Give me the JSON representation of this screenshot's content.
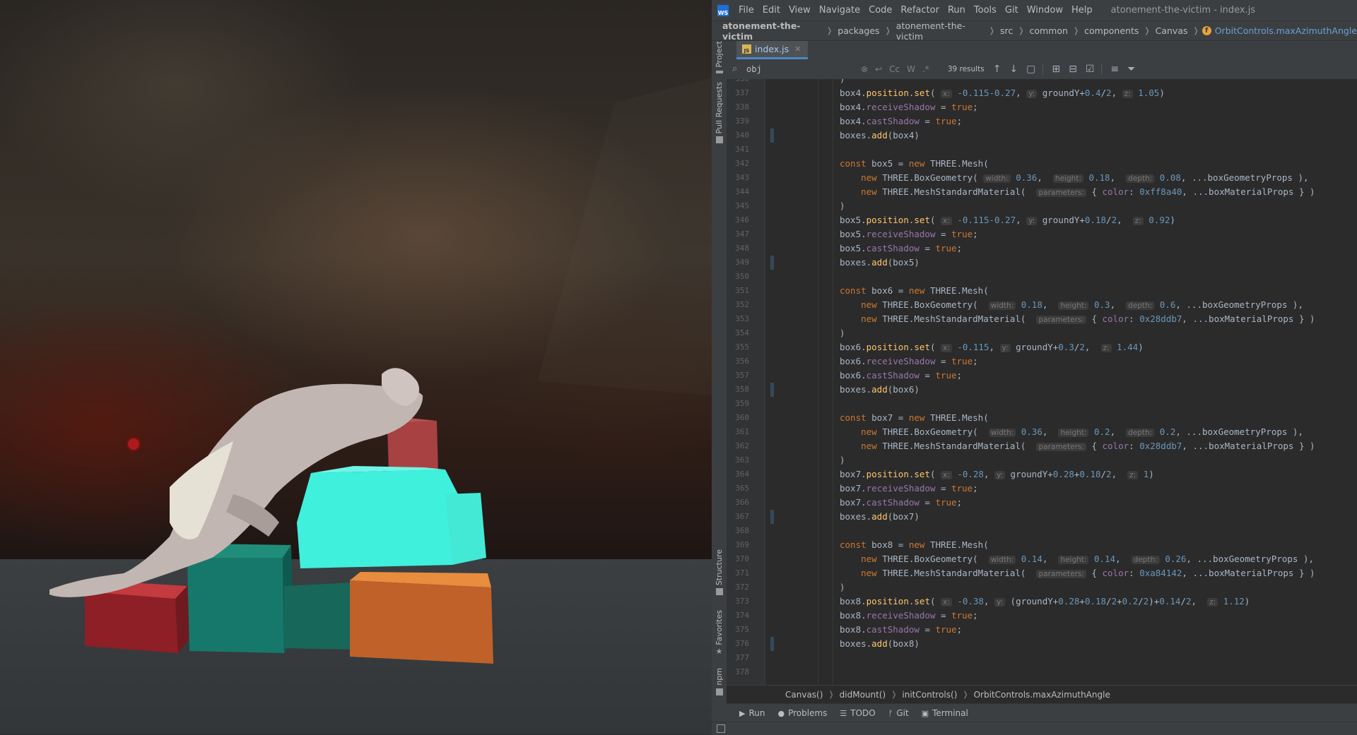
{
  "menubar": {
    "logo": "WS",
    "items": [
      "File",
      "Edit",
      "View",
      "Navigate",
      "Code",
      "Refactor",
      "Run",
      "Tools",
      "Git",
      "Window",
      "Help"
    ],
    "window_title": "atonement-the-victim - index.js"
  },
  "breadcrumbs": {
    "items": [
      "atonement-the-victim",
      "packages",
      "atonement-the-victim",
      "src",
      "common",
      "components",
      "Canvas"
    ],
    "last": "OrbitControls.maxAzimuthAngle"
  },
  "side_tabs": {
    "project": "Project",
    "pull_requests": "Pull Requests",
    "structure": "Structure",
    "favorites": "Favorites",
    "npm": "npm"
  },
  "editor_tab": {
    "name": "index.js",
    "icon": "JS"
  },
  "search": {
    "query": "obj",
    "case_btn": "Cc",
    "word_btn": "W",
    "regex_btn": ".*",
    "results": "39 results"
  },
  "code": {
    "first_line_number": 336,
    "lines": [
      [
        [
          "p",
          ")"
        ]
      ],
      [
        [
          "p",
          "box4."
        ],
        [
          "f",
          "position"
        ],
        [
          "p",
          "."
        ],
        [
          "f",
          "set"
        ],
        [
          "p",
          "( "
        ],
        [
          "h",
          "x:"
        ],
        [
          "p",
          " "
        ],
        [
          "n",
          "-0.115-0.27"
        ],
        [
          "p",
          ", "
        ],
        [
          "h",
          "y:"
        ],
        [
          "p",
          " groundY+"
        ],
        [
          "n",
          "0.4"
        ],
        [
          "p",
          "/"
        ],
        [
          "n",
          "2"
        ],
        [
          "p",
          ", "
        ],
        [
          "h",
          "z:"
        ],
        [
          "p",
          " "
        ],
        [
          "n",
          "1.05"
        ],
        [
          "p",
          ")"
        ]
      ],
      [
        [
          "p",
          "box4."
        ],
        [
          "r",
          "receiveShadow"
        ],
        [
          "p",
          " = "
        ],
        [
          "k",
          "true"
        ],
        [
          "p",
          ";"
        ]
      ],
      [
        [
          "p",
          "box4."
        ],
        [
          "r",
          "castShadow"
        ],
        [
          "p",
          " = "
        ],
        [
          "k",
          "true"
        ],
        [
          "p",
          ";"
        ]
      ],
      [
        [
          "p",
          "boxes."
        ],
        [
          "f",
          "add"
        ],
        [
          "p",
          "(box4)"
        ]
      ],
      [],
      [
        [
          "k",
          "const "
        ],
        [
          "p",
          "box5 = "
        ],
        [
          "k",
          "new "
        ],
        [
          "p",
          "THREE.Mesh("
        ]
      ],
      [
        [
          "p",
          "    "
        ],
        [
          "k",
          "new "
        ],
        [
          "p",
          "THREE.BoxGeometry( "
        ],
        [
          "h",
          "width:"
        ],
        [
          "p",
          " "
        ],
        [
          "n",
          "0.36"
        ],
        [
          "p",
          ",  "
        ],
        [
          "h",
          "height:"
        ],
        [
          "p",
          " "
        ],
        [
          "n",
          "0.18"
        ],
        [
          "p",
          ",  "
        ],
        [
          "h",
          "depth:"
        ],
        [
          "p",
          " "
        ],
        [
          "n",
          "0.08"
        ],
        [
          "p",
          ", ...boxGeometryProps ),"
        ]
      ],
      [
        [
          "p",
          "    "
        ],
        [
          "k",
          "new "
        ],
        [
          "p",
          "THREE.MeshStandardMaterial(  "
        ],
        [
          "h",
          "parameters:"
        ],
        [
          "p",
          " { "
        ],
        [
          "r",
          "color"
        ],
        [
          "p",
          ": "
        ],
        [
          "n",
          "0xff8a40"
        ],
        [
          "p",
          ", ...boxMaterialProps } )"
        ]
      ],
      [
        [
          "p",
          ")"
        ]
      ],
      [
        [
          "p",
          "box5."
        ],
        [
          "f",
          "position"
        ],
        [
          "p",
          "."
        ],
        [
          "f",
          "set"
        ],
        [
          "p",
          "( "
        ],
        [
          "h",
          "x:"
        ],
        [
          "p",
          " "
        ],
        [
          "n",
          "-0.115-0.27"
        ],
        [
          "p",
          ", "
        ],
        [
          "h",
          "y:"
        ],
        [
          "p",
          " groundY+"
        ],
        [
          "n",
          "0.18"
        ],
        [
          "p",
          "/"
        ],
        [
          "n",
          "2"
        ],
        [
          "p",
          ",  "
        ],
        [
          "h",
          "z:"
        ],
        [
          "p",
          " "
        ],
        [
          "n",
          "0.92"
        ],
        [
          "p",
          ")"
        ]
      ],
      [
        [
          "p",
          "box5."
        ],
        [
          "r",
          "receiveShadow"
        ],
        [
          "p",
          " = "
        ],
        [
          "k",
          "true"
        ],
        [
          "p",
          ";"
        ]
      ],
      [
        [
          "p",
          "box5."
        ],
        [
          "r",
          "castShadow"
        ],
        [
          "p",
          " = "
        ],
        [
          "k",
          "true"
        ],
        [
          "p",
          ";"
        ]
      ],
      [
        [
          "p",
          "boxes."
        ],
        [
          "f",
          "add"
        ],
        [
          "p",
          "(box5)"
        ]
      ],
      [],
      [
        [
          "k",
          "const "
        ],
        [
          "p",
          "box6 = "
        ],
        [
          "k",
          "new "
        ],
        [
          "p",
          "THREE.Mesh("
        ]
      ],
      [
        [
          "p",
          "    "
        ],
        [
          "k",
          "new "
        ],
        [
          "p",
          "THREE.BoxGeometry(  "
        ],
        [
          "h",
          "width:"
        ],
        [
          "p",
          " "
        ],
        [
          "n",
          "0.18"
        ],
        [
          "p",
          ",  "
        ],
        [
          "h",
          "height:"
        ],
        [
          "p",
          " "
        ],
        [
          "n",
          "0.3"
        ],
        [
          "p",
          ",  "
        ],
        [
          "h",
          "depth:"
        ],
        [
          "p",
          " "
        ],
        [
          "n",
          "0.6"
        ],
        [
          "p",
          ", ...boxGeometryProps ),"
        ]
      ],
      [
        [
          "p",
          "    "
        ],
        [
          "k",
          "new "
        ],
        [
          "p",
          "THREE.MeshStandardMaterial(  "
        ],
        [
          "h",
          "parameters:"
        ],
        [
          "p",
          " { "
        ],
        [
          "r",
          "color"
        ],
        [
          "p",
          ": "
        ],
        [
          "n",
          "0x28ddb7"
        ],
        [
          "p",
          ", ...boxMaterialProps } )"
        ]
      ],
      [
        [
          "p",
          ")"
        ]
      ],
      [
        [
          "p",
          "box6."
        ],
        [
          "f",
          "position"
        ],
        [
          "p",
          "."
        ],
        [
          "f",
          "set"
        ],
        [
          "p",
          "( "
        ],
        [
          "h",
          "x:"
        ],
        [
          "p",
          " "
        ],
        [
          "n",
          "-0.115"
        ],
        [
          "p",
          ", "
        ],
        [
          "h",
          "y:"
        ],
        [
          "p",
          " groundY+"
        ],
        [
          "n",
          "0.3"
        ],
        [
          "p",
          "/"
        ],
        [
          "n",
          "2"
        ],
        [
          "p",
          ",  "
        ],
        [
          "h",
          "z:"
        ],
        [
          "p",
          " "
        ],
        [
          "n",
          "1.44"
        ],
        [
          "p",
          ")"
        ]
      ],
      [
        [
          "p",
          "box6."
        ],
        [
          "r",
          "receiveShadow"
        ],
        [
          "p",
          " = "
        ],
        [
          "k",
          "true"
        ],
        [
          "p",
          ";"
        ]
      ],
      [
        [
          "p",
          "box6."
        ],
        [
          "r",
          "castShadow"
        ],
        [
          "p",
          " = "
        ],
        [
          "k",
          "true"
        ],
        [
          "p",
          ";"
        ]
      ],
      [
        [
          "p",
          "boxes."
        ],
        [
          "f",
          "add"
        ],
        [
          "p",
          "(box6)"
        ]
      ],
      [],
      [
        [
          "k",
          "const "
        ],
        [
          "p",
          "box7 = "
        ],
        [
          "k",
          "new "
        ],
        [
          "p",
          "THREE.Mesh("
        ]
      ],
      [
        [
          "p",
          "    "
        ],
        [
          "k",
          "new "
        ],
        [
          "p",
          "THREE.BoxGeometry(  "
        ],
        [
          "h",
          "width:"
        ],
        [
          "p",
          " "
        ],
        [
          "n",
          "0.36"
        ],
        [
          "p",
          ",  "
        ],
        [
          "h",
          "height:"
        ],
        [
          "p",
          " "
        ],
        [
          "n",
          "0.2"
        ],
        [
          "p",
          ",  "
        ],
        [
          "h",
          "depth:"
        ],
        [
          "p",
          " "
        ],
        [
          "n",
          "0.2"
        ],
        [
          "p",
          ", ...boxGeometryProps ),"
        ]
      ],
      [
        [
          "p",
          "    "
        ],
        [
          "k",
          "new "
        ],
        [
          "p",
          "THREE.MeshStandardMaterial(  "
        ],
        [
          "h",
          "parameters:"
        ],
        [
          "p",
          " { "
        ],
        [
          "r",
          "color"
        ],
        [
          "p",
          ": "
        ],
        [
          "n",
          "0x28ddb7"
        ],
        [
          "p",
          ", ...boxMaterialProps } )"
        ]
      ],
      [
        [
          "p",
          ")"
        ]
      ],
      [
        [
          "p",
          "box7."
        ],
        [
          "f",
          "position"
        ],
        [
          "p",
          "."
        ],
        [
          "f",
          "set"
        ],
        [
          "p",
          "( "
        ],
        [
          "h",
          "x:"
        ],
        [
          "p",
          " "
        ],
        [
          "n",
          "-0.28"
        ],
        [
          "p",
          ", "
        ],
        [
          "h",
          "y:"
        ],
        [
          "p",
          " groundY+"
        ],
        [
          "n",
          "0.28"
        ],
        [
          "p",
          "+"
        ],
        [
          "n",
          "0.18"
        ],
        [
          "p",
          "/"
        ],
        [
          "n",
          "2"
        ],
        [
          "p",
          ",  "
        ],
        [
          "h",
          "z:"
        ],
        [
          "p",
          " "
        ],
        [
          "n",
          "1"
        ],
        [
          "p",
          ")"
        ]
      ],
      [
        [
          "p",
          "box7."
        ],
        [
          "r",
          "receiveShadow"
        ],
        [
          "p",
          " = "
        ],
        [
          "k",
          "true"
        ],
        [
          "p",
          ";"
        ]
      ],
      [
        [
          "p",
          "box7."
        ],
        [
          "r",
          "castShadow"
        ],
        [
          "p",
          " = "
        ],
        [
          "k",
          "true"
        ],
        [
          "p",
          ";"
        ]
      ],
      [
        [
          "p",
          "boxes."
        ],
        [
          "f",
          "add"
        ],
        [
          "p",
          "(box7)"
        ]
      ],
      [],
      [
        [
          "k",
          "const "
        ],
        [
          "p",
          "box8 = "
        ],
        [
          "k",
          "new "
        ],
        [
          "p",
          "THREE.Mesh("
        ]
      ],
      [
        [
          "p",
          "    "
        ],
        [
          "k",
          "new "
        ],
        [
          "p",
          "THREE.BoxGeometry(  "
        ],
        [
          "h",
          "width:"
        ],
        [
          "p",
          " "
        ],
        [
          "n",
          "0.14"
        ],
        [
          "p",
          ",  "
        ],
        [
          "h",
          "height:"
        ],
        [
          "p",
          " "
        ],
        [
          "n",
          "0.14"
        ],
        [
          "p",
          ",  "
        ],
        [
          "h",
          "depth:"
        ],
        [
          "p",
          " "
        ],
        [
          "n",
          "0.26"
        ],
        [
          "p",
          ", ...boxGeometryProps ),"
        ]
      ],
      [
        [
          "p",
          "    "
        ],
        [
          "k",
          "new "
        ],
        [
          "p",
          "THREE.MeshStandardMaterial(  "
        ],
        [
          "h",
          "parameters:"
        ],
        [
          "p",
          " { "
        ],
        [
          "r",
          "color"
        ],
        [
          "p",
          ": "
        ],
        [
          "n",
          "0xa84142"
        ],
        [
          "p",
          ", ...boxMaterialProps } )"
        ]
      ],
      [
        [
          "p",
          ")"
        ]
      ],
      [
        [
          "p",
          "box8."
        ],
        [
          "f",
          "position"
        ],
        [
          "p",
          "."
        ],
        [
          "f",
          "set"
        ],
        [
          "p",
          "( "
        ],
        [
          "h",
          "x:"
        ],
        [
          "p",
          " "
        ],
        [
          "n",
          "-0.38"
        ],
        [
          "p",
          ", "
        ],
        [
          "h",
          "y:"
        ],
        [
          "p",
          " (groundY+"
        ],
        [
          "n",
          "0.28"
        ],
        [
          "p",
          "+"
        ],
        [
          "n",
          "0.18"
        ],
        [
          "p",
          "/"
        ],
        [
          "n",
          "2"
        ],
        [
          "p",
          "+"
        ],
        [
          "n",
          "0.2"
        ],
        [
          "p",
          "/"
        ],
        [
          "n",
          "2"
        ],
        [
          "p",
          ")+"
        ],
        [
          "n",
          "0.14"
        ],
        [
          "p",
          "/"
        ],
        [
          "n",
          "2"
        ],
        [
          "p",
          ",  "
        ],
        [
          "h",
          "z:"
        ],
        [
          "p",
          " "
        ],
        [
          "n",
          "1.12"
        ],
        [
          "p",
          ")"
        ]
      ],
      [
        [
          "p",
          "box8."
        ],
        [
          "r",
          "receiveShadow"
        ],
        [
          "p",
          " = "
        ],
        [
          "k",
          "true"
        ],
        [
          "p",
          ";"
        ]
      ],
      [
        [
          "p",
          "box8."
        ],
        [
          "r",
          "castShadow"
        ],
        [
          "p",
          " = "
        ],
        [
          "k",
          "true"
        ],
        [
          "p",
          ";"
        ]
      ],
      [
        [
          "p",
          "boxes."
        ],
        [
          "f",
          "add"
        ],
        [
          "p",
          "(box8)"
        ]
      ],
      [],
      []
    ]
  },
  "nav_crumbs": [
    "Canvas()",
    "didMount()",
    "initControls()",
    "OrbitControls.maxAzimuthAngle"
  ],
  "tool_windows": [
    {
      "icon": "▶",
      "label": "Run"
    },
    {
      "icon": "●",
      "label": "Problems"
    },
    {
      "icon": "☰",
      "label": "TODO"
    },
    {
      "icon": "ᚠ",
      "label": "Git"
    },
    {
      "icon": "▣",
      "label": "Terminal"
    }
  ],
  "colors": {
    "accent": "#4a88c7",
    "box_red": "#a84142",
    "box_teal": "#28ddb7",
    "box_orange": "#ff8a40"
  }
}
